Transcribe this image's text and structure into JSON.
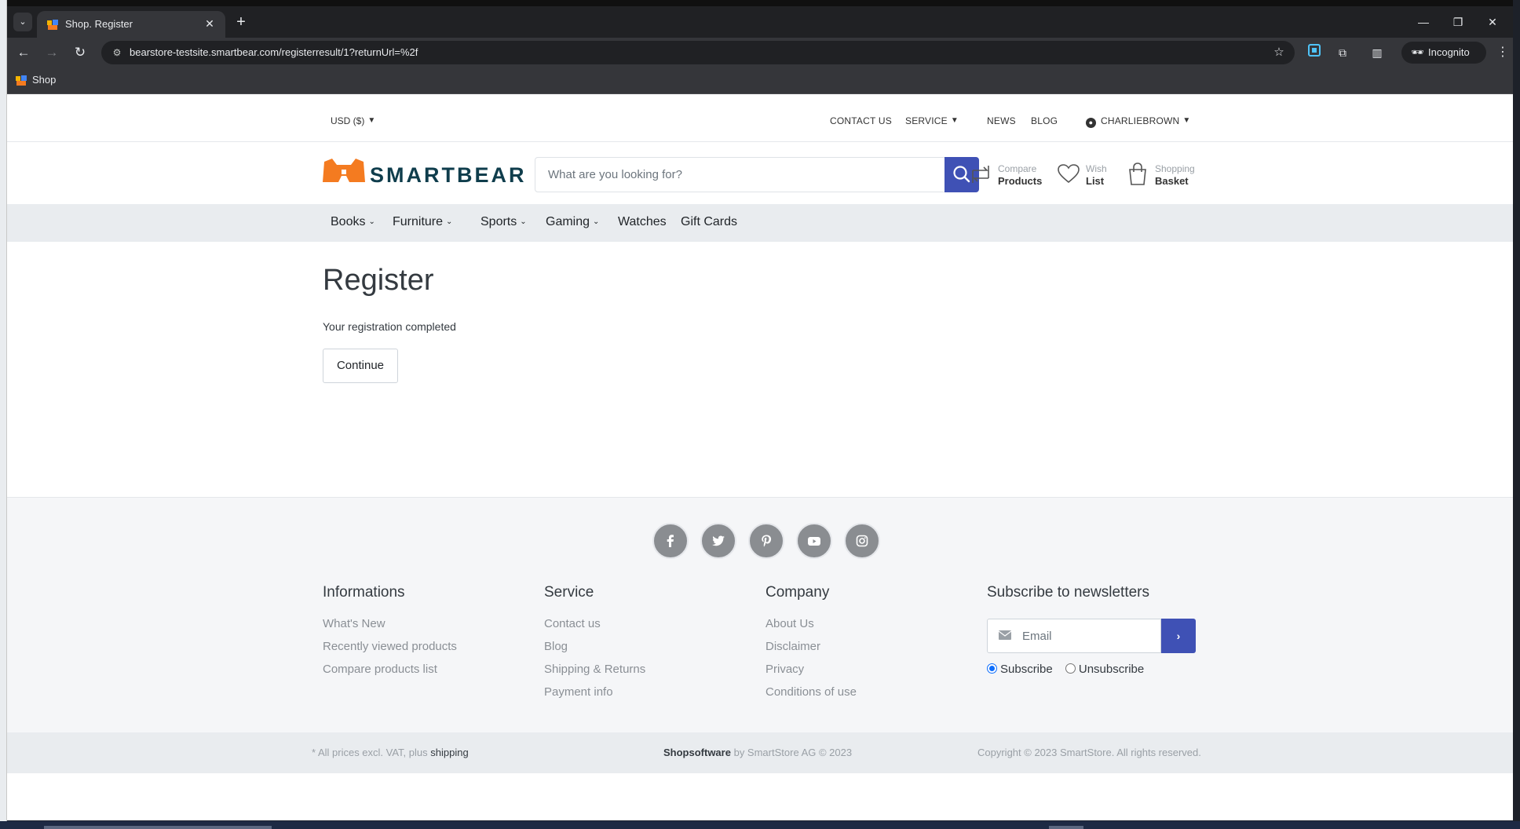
{
  "browser": {
    "tab_title": "Shop. Register",
    "url": "bearstore-testsite.smartbear.com/registerresult/1?returnUrl=%2f",
    "incognito_label": "Incognito",
    "bookmark_label": "Shop"
  },
  "utility": {
    "currency": "USD  ($)",
    "contact": "CONTACT US",
    "service": "SERVICE",
    "news": "NEWS",
    "blog": "BLOG",
    "user": "CHARLIEBROWN"
  },
  "header": {
    "logo_text": "SMARTBEAR",
    "search_placeholder": "What are you looking for?",
    "compare_top": "Compare",
    "compare_bottom": "Products",
    "wish_top": "Wish",
    "wish_bottom": "List",
    "basket_top": "Shopping",
    "basket_bottom": "Basket"
  },
  "nav": {
    "items": [
      "Books",
      "Furniture",
      "Sports",
      "Gaming",
      "Watches",
      "Gift Cards"
    ]
  },
  "content": {
    "title": "Register",
    "message": "Your registration completed",
    "continue_label": "Continue"
  },
  "footer": {
    "informations": {
      "heading": "Informations",
      "links": [
        "What's New",
        "Recently viewed products",
        "Compare products list"
      ]
    },
    "service": {
      "heading": "Service",
      "links": [
        "Contact us",
        "Blog",
        "Shipping & Returns",
        "Payment info"
      ]
    },
    "company": {
      "heading": "Company",
      "links": [
        "About Us",
        "Disclaimer",
        "Privacy",
        "Conditions of use"
      ]
    },
    "newsletter": {
      "heading": "Subscribe to newsletters",
      "email_placeholder": "Email",
      "subscribe": "Subscribe",
      "unsubscribe": "Unsubscribe"
    }
  },
  "legal": {
    "prices_prefix": "* All prices excl. VAT, plus",
    "prices_link": "shipping",
    "brand": "Shopsoftware",
    "brand_suffix": "by SmartStore AG © 2023",
    "copyright": "Copyright © 2023 SmartStore. All rights reserved."
  },
  "colors": {
    "accent": "#3f51b5",
    "logo_orange": "#f47b20",
    "logo_navy": "#0f3d4c"
  }
}
